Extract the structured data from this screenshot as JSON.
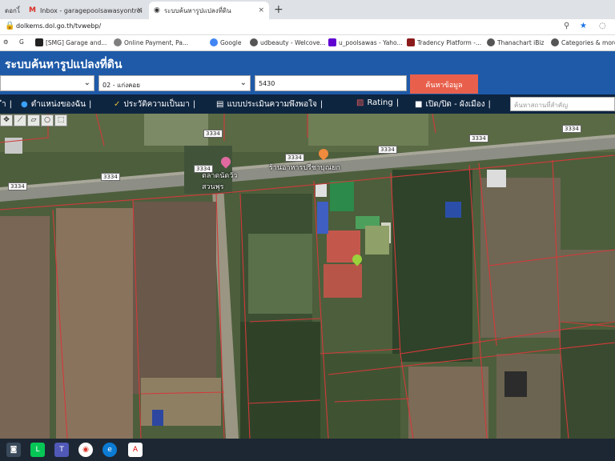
{
  "browser": {
    "tabs": [
      {
        "label": "ดอกไ้",
        "active": false
      },
      {
        "label": "Inbox - garagepoolsawasyontroi",
        "active": false
      },
      {
        "label": "ระบบค้นหารูปแปลงที่ดิน",
        "active": true
      }
    ],
    "new_tab_symbol": "+",
    "close_symbol": "×",
    "url": "dolkems.dol.go.th/tvwebp/",
    "bookmarks": [
      {
        "label": "[SMG] Garage and...",
        "color": "#222222"
      },
      {
        "label": "Online Payment, Pa...",
        "color": "#7f7f7f"
      },
      {
        "label": "Google",
        "color": "#4285f4"
      },
      {
        "label": "udbeauty - Welcove...",
        "color": "#555555"
      },
      {
        "label": "u_poolsawas - Yaho...",
        "color": "#6001d2"
      },
      {
        "label": "Tradency Platform -...",
        "color": "#8b1a1a"
      },
      {
        "label": "Thanachart iBiz",
        "color": "#555555"
      },
      {
        "label": "Categories & more",
        "color": "#555555"
      }
    ]
  },
  "app": {
    "title": "ระบบค้นหารูปแปลงที่ดิน",
    "search": {
      "province_value": "",
      "district_value": "02 - แก่งคอย",
      "parcel_value": "5430",
      "button_label": "ค้นหาข้อมูล"
    },
    "menu": [
      {
        "label": "ำ",
        "icon": ""
      },
      {
        "label": "ตำแหน่งของฉัน",
        "icon": "globe-icon"
      },
      {
        "label": "ประวัติความเป็นมา",
        "icon": "sprout-icon"
      },
      {
        "label": "แบบประเมินความพึงพอใจ",
        "icon": "document-icon"
      },
      {
        "label": "Rating",
        "icon": "chart-icon"
      },
      {
        "label": "เปิด/ปิด - ผังเมือง",
        "icon": "square-icon"
      }
    ],
    "place_search_placeholder": "ค้นหาสถานที่สำคัญ",
    "map": {
      "road_labels": [
        "3334",
        "3334",
        "3334",
        "3334",
        "3334",
        "3334",
        "3334",
        "3334"
      ],
      "poi": [
        {
          "label": "ตลาดนัดวัว\nสวนพุร",
          "color": "#e06aa0"
        },
        {
          "label": "ร้านอาหารปรีชาบุณยก",
          "color": "#f08a3c"
        }
      ]
    }
  }
}
